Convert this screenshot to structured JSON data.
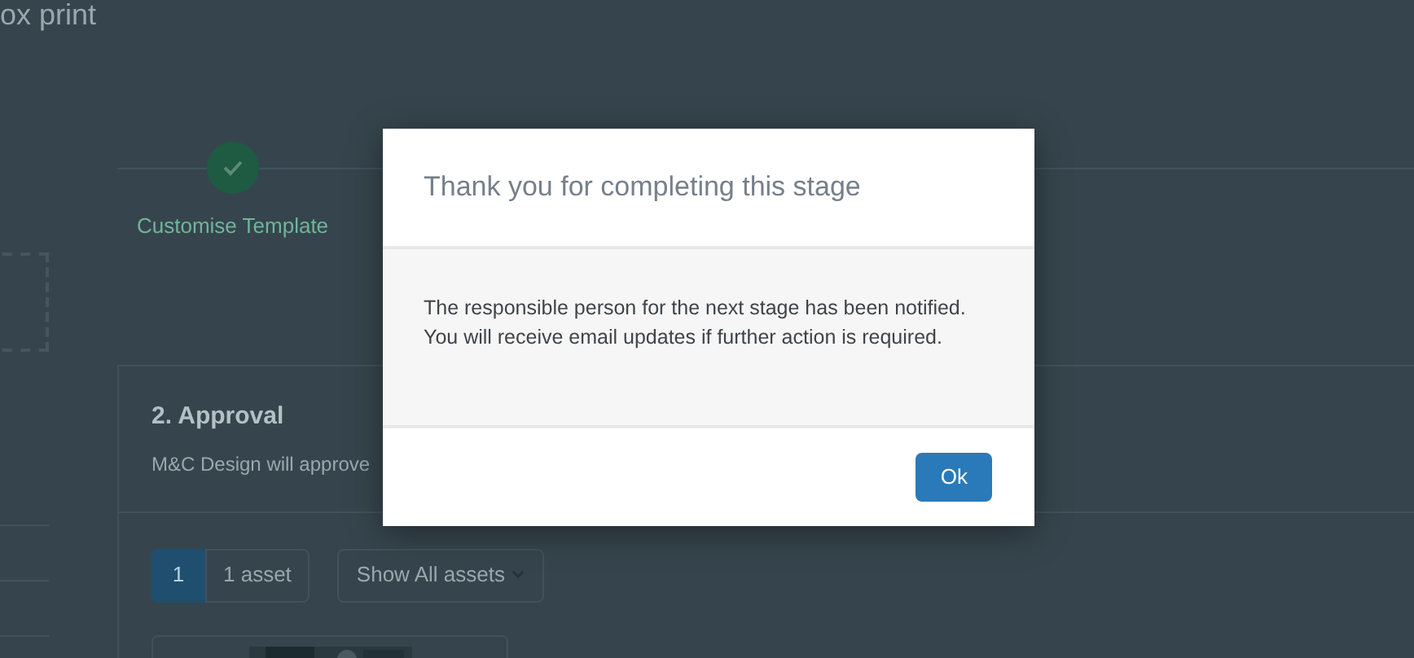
{
  "page": {
    "title": "ox print"
  },
  "stepper": {
    "steps": [
      {
        "label": "Customise Template",
        "done": true
      }
    ]
  },
  "approval": {
    "title": "2. Approval",
    "description": "M&C Design will approve",
    "pager": {
      "page": "1",
      "count": "1 asset"
    },
    "filter": {
      "label": "Show All assets"
    }
  },
  "dialog": {
    "title": "Thank you for completing this stage",
    "message": [
      "The responsible person for the next stage has been notified.",
      "You will receive email updates if further action is required."
    ],
    "buttons": [
      "Ok"
    ]
  }
}
